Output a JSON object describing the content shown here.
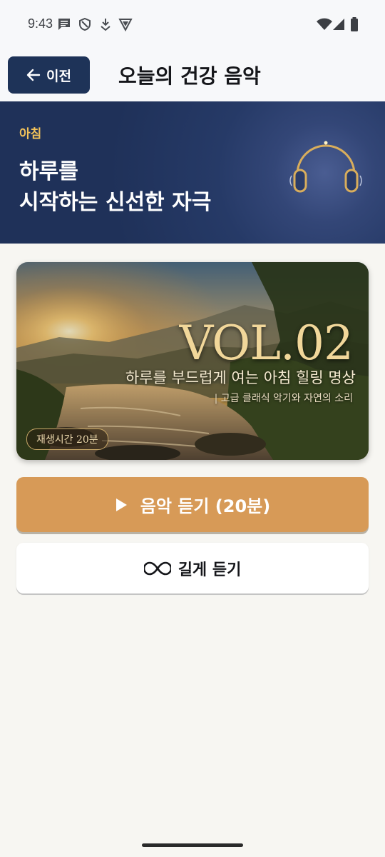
{
  "status_bar": {
    "time": "9:43",
    "left_icons": [
      "message-icon",
      "shield-icon",
      "download-icon",
      "vpn-icon"
    ],
    "right_icons": [
      "wifi-icon",
      "signal-icon",
      "battery-icon"
    ]
  },
  "header": {
    "back_label": "이전",
    "title": "오늘의 건강 음악"
  },
  "hero": {
    "tag": "아침",
    "line1": "하루를",
    "line2": "시작하는 신선한 자극",
    "icon": "headphones-icon"
  },
  "album": {
    "volume": "VOL.02",
    "subtitle": "하루를 부드럽게 여는 아침 힐링 명상",
    "description": "| 고급 클래식 악기와 자연의 소리",
    "duration_badge": "재생시간 20분"
  },
  "actions": {
    "play_label": "음악 듣기 (20분)",
    "long_listen_label": "길게 듣기"
  },
  "colors": {
    "header_button": "#1e3358",
    "hero_bg": "#233760",
    "accent_tag": "#f2c25a",
    "play_button": "#d79a57",
    "background": "#f7f6f2"
  }
}
